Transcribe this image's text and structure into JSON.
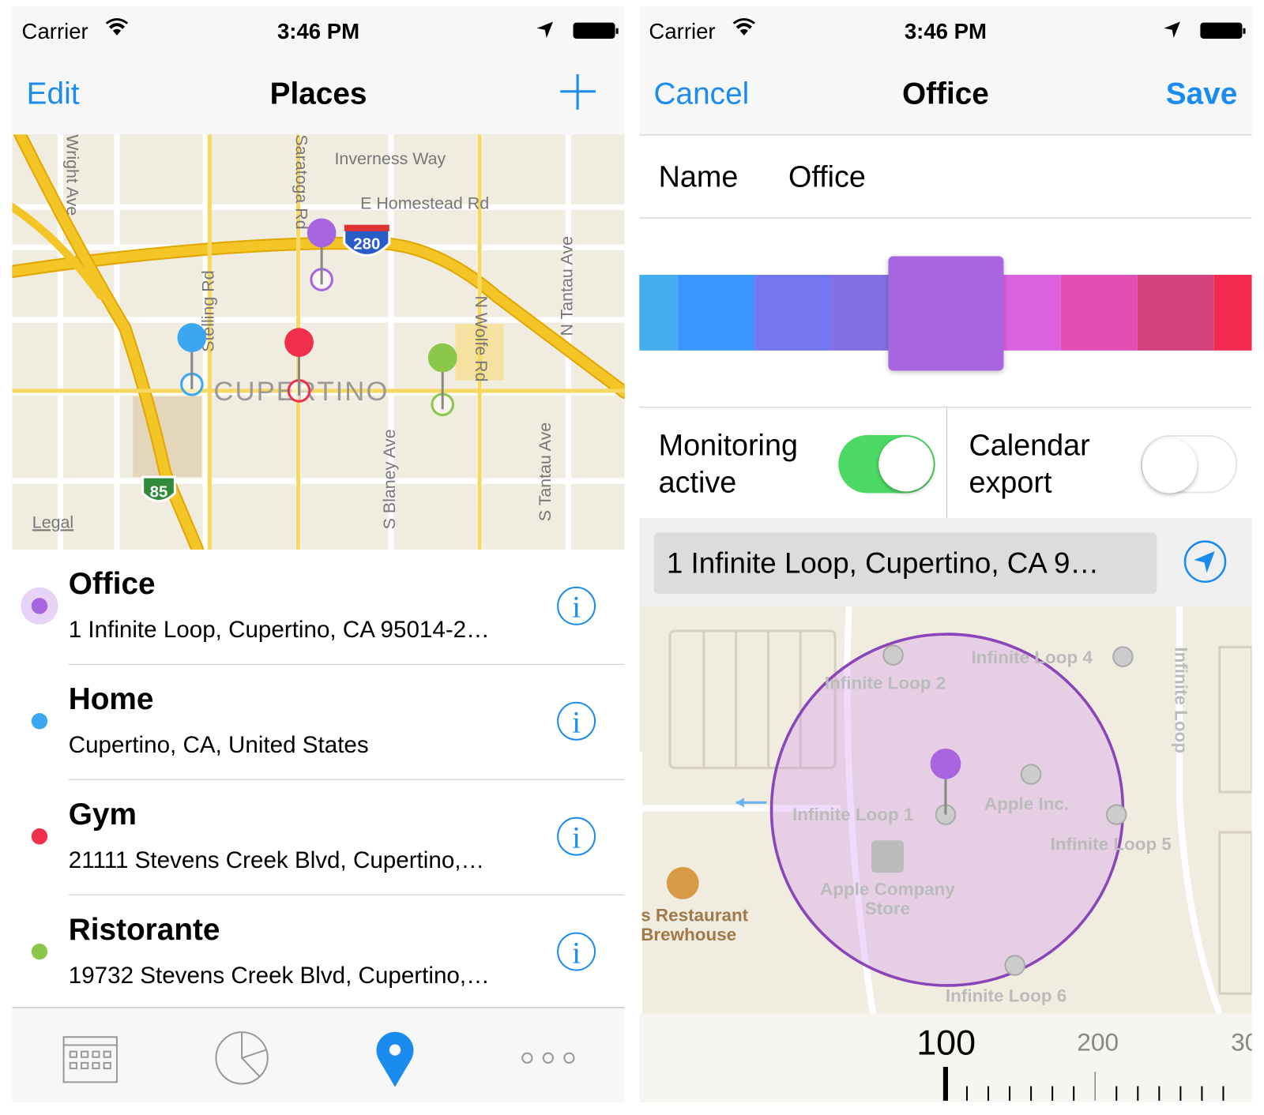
{
  "status_bar": {
    "carrier": "Carrier",
    "time": "3:46 PM"
  },
  "left": {
    "nav": {
      "left_button": "Edit",
      "title": "Places",
      "right_icon": "plus-icon"
    },
    "map": {
      "labels": [
        "Inverness Way",
        "E Homestead Rd",
        "280",
        "85",
        "CUPERTINO",
        "N Wolfe Rd",
        "N Tantau Ave",
        "S Tantau Ave",
        "S Blaney Ave",
        "Stelling Rd",
        "Saratoga Rd",
        "Wright Ave",
        "Legal"
      ]
    },
    "places": [
      {
        "name": "Office",
        "address": "1 Infinite Loop, Cupertino, CA  95014-2…",
        "color": "#a865e0"
      },
      {
        "name": "Home",
        "address": "Cupertino, CA, United States",
        "color": "#3aa7f0"
      },
      {
        "name": "Gym",
        "address": "21111 Stevens Creek Blvd, Cupertino,…",
        "color": "#f0304a"
      },
      {
        "name": "Ristorante",
        "address": "19732 Stevens Creek Blvd, Cupertino,…",
        "color": "#8ac74a"
      }
    ],
    "tabs": [
      {
        "icon": "calendar-icon"
      },
      {
        "icon": "pie-chart-icon"
      },
      {
        "icon": "location-pin-icon",
        "selected": true
      },
      {
        "icon": "more-icon"
      }
    ]
  },
  "right": {
    "nav": {
      "left_button": "Cancel",
      "title": "Office",
      "right_button": "Save"
    },
    "name_label": "Name",
    "name_value": "Office",
    "colors": [
      "#45aef0",
      "#3a95fc",
      "#7577f0",
      "#8470e6",
      "#a865e0",
      "#dc62e0",
      "#e04db4",
      "#d5427c",
      "#f42b50"
    ],
    "selected_color": "#a865e0",
    "monitoring": {
      "label1": "Monitoring",
      "label2": "active",
      "on": true
    },
    "calendar": {
      "label1": "Calendar",
      "label2": "export",
      "on": false
    },
    "address": "1 Infinite Loop, Cupertino, CA  9…",
    "map": {
      "labels": [
        "Infinite Loop 4",
        "Infinite Loop 2",
        "Infinite Loop 1",
        "Apple Inc.",
        "Infinite Loop 5",
        "Apple Company",
        "Store",
        "s Restaurant",
        "Brewhouse",
        "Infinite Loop 6",
        "Infinite Loop"
      ]
    },
    "ruler": {
      "selected": "100",
      "next": "200",
      "next2": "30"
    }
  },
  "accent": "#1a8cf0",
  "toggle_on": "#4cd964"
}
